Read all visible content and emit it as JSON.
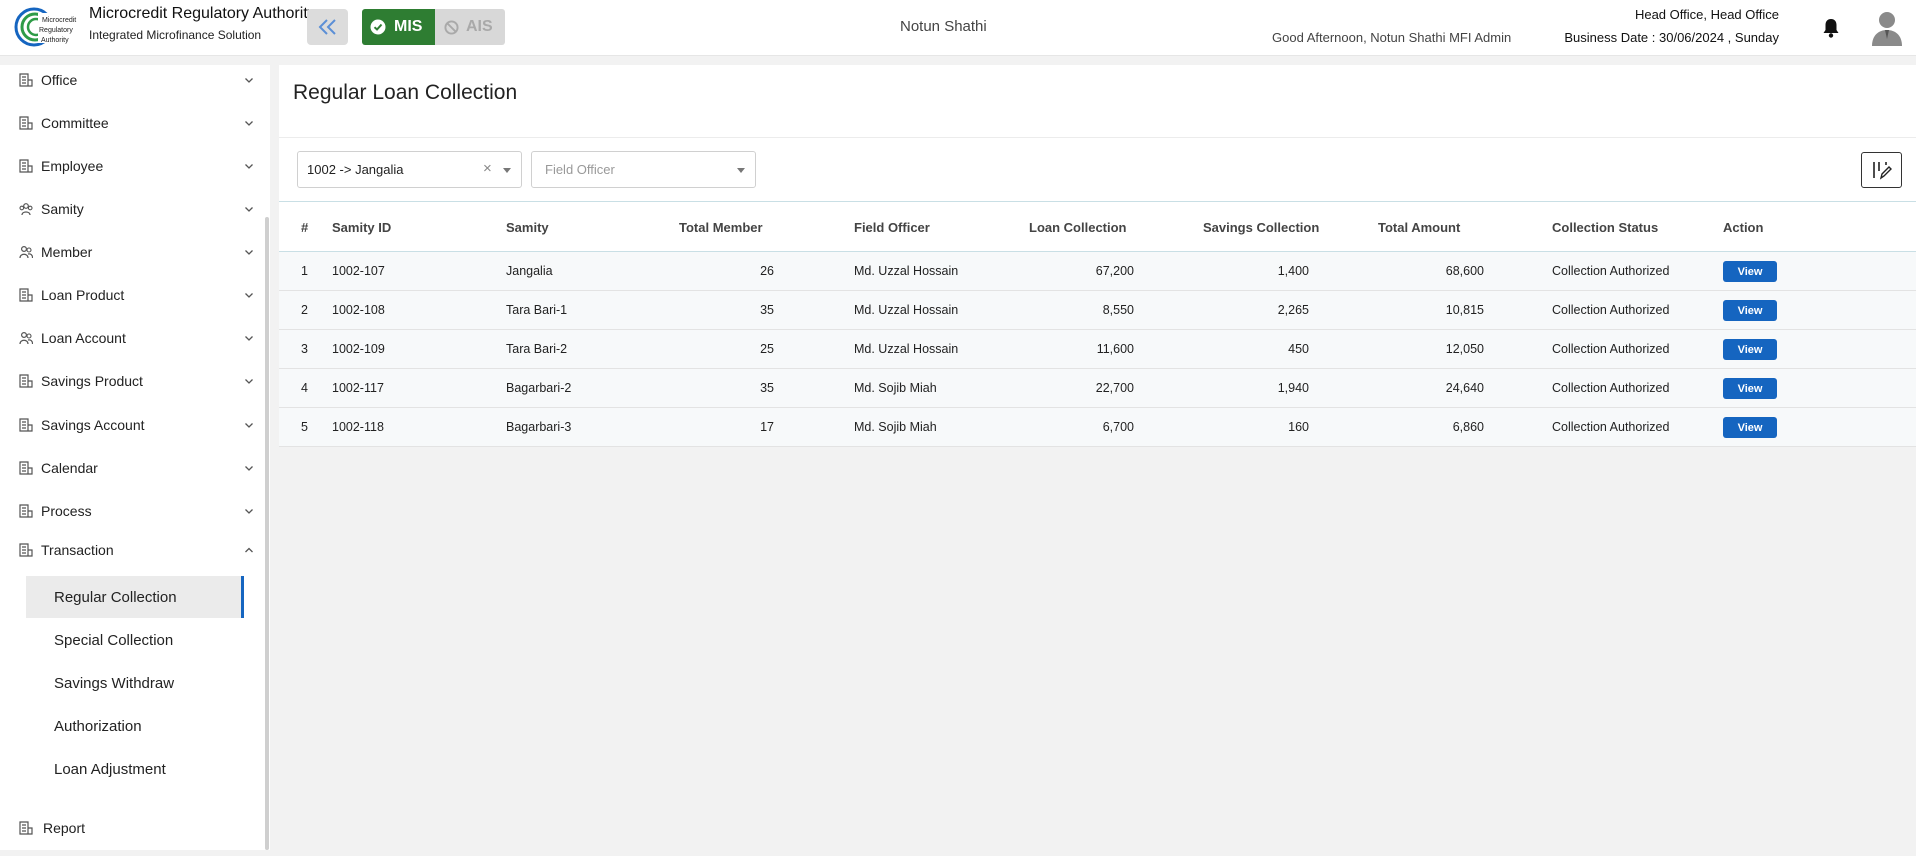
{
  "header": {
    "brand_title": "Microcredit Regulatory Authority",
    "brand_subtitle": "Integrated Microfinance Solution",
    "logo_text": [
      "Microcredit",
      "Regulatory",
      "Authority"
    ],
    "mis_label": "MIS",
    "ais_label": "AIS",
    "org_name": "Notun Shathi",
    "greeting": "Good Afternoon, Notun Shathi MFI Admin",
    "office": "Head Office, Head Office",
    "business_date": "Business Date : 30/06/2024 , Sunday",
    "colors": {
      "mis": "#2e7d32",
      "brand_green": "#2e9b47",
      "brand_blue": "#1565c0"
    }
  },
  "sidebar": {
    "items": [
      {
        "label": "Office",
        "icon": "building-icon"
      },
      {
        "label": "Committee",
        "icon": "building-icon"
      },
      {
        "label": "Employee",
        "icon": "building-icon"
      },
      {
        "label": "Samity",
        "icon": "group-icon"
      },
      {
        "label": "Member",
        "icon": "users-icon"
      },
      {
        "label": "Loan Product",
        "icon": "building-icon"
      },
      {
        "label": "Loan Account",
        "icon": "users-icon"
      },
      {
        "label": "Savings Product",
        "icon": "building-icon"
      },
      {
        "label": "Savings Account",
        "icon": "building-icon"
      },
      {
        "label": "Calendar",
        "icon": "building-icon"
      },
      {
        "label": "Process",
        "icon": "building-icon"
      },
      {
        "label": "Transaction",
        "icon": "building-icon"
      }
    ],
    "sub_items": [
      {
        "label": "Regular Collection",
        "active": true
      },
      {
        "label": "Special Collection"
      },
      {
        "label": "Savings Withdraw"
      },
      {
        "label": "Authorization"
      },
      {
        "label": "Loan Adjustment"
      }
    ],
    "report_label": "Report"
  },
  "main": {
    "title": "Regular Loan Collection",
    "branch_select": "1002 -> Jangalia",
    "field_officer_placeholder": "Field Officer",
    "table": {
      "headers": [
        "#",
        "Samity ID",
        "Samity",
        "Total Member",
        "Field Officer",
        "Loan Collection",
        "Savings Collection",
        "Total Amount",
        "Collection Status",
        "Action"
      ],
      "rows": [
        {
          "no": "1",
          "samity_id": "1002-107",
          "samity": "Jangalia",
          "total_member": "26",
          "field_officer": "Md. Uzzal Hossain",
          "loan": "67,200",
          "savings": "1,400",
          "total": "68,600",
          "status": "Collection Authorized",
          "action": "View"
        },
        {
          "no": "2",
          "samity_id": "1002-108",
          "samity": "Tara Bari-1",
          "total_member": "35",
          "field_officer": "Md. Uzzal Hossain",
          "loan": "8,550",
          "savings": "2,265",
          "total": "10,815",
          "status": "Collection Authorized",
          "action": "View"
        },
        {
          "no": "3",
          "samity_id": "1002-109",
          "samity": "Tara Bari-2",
          "total_member": "25",
          "field_officer": "Md. Uzzal Hossain",
          "loan": "11,600",
          "savings": "450",
          "total": "12,050",
          "status": "Collection Authorized",
          "action": "View"
        },
        {
          "no": "4",
          "samity_id": "1002-117",
          "samity": "Bagarbari-2",
          "total_member": "35",
          "field_officer": "Md. Sojib Miah",
          "loan": "22,700",
          "savings": "1,940",
          "total": "24,640",
          "status": "Collection Authorized",
          "action": "View"
        },
        {
          "no": "5",
          "samity_id": "1002-118",
          "samity": "Bagarbari-3",
          "total_member": "17",
          "field_officer": "Md. Sojib Miah",
          "loan": "6,700",
          "savings": "160",
          "total": "6,860",
          "status": "Collection Authorized",
          "action": "View"
        }
      ]
    }
  }
}
